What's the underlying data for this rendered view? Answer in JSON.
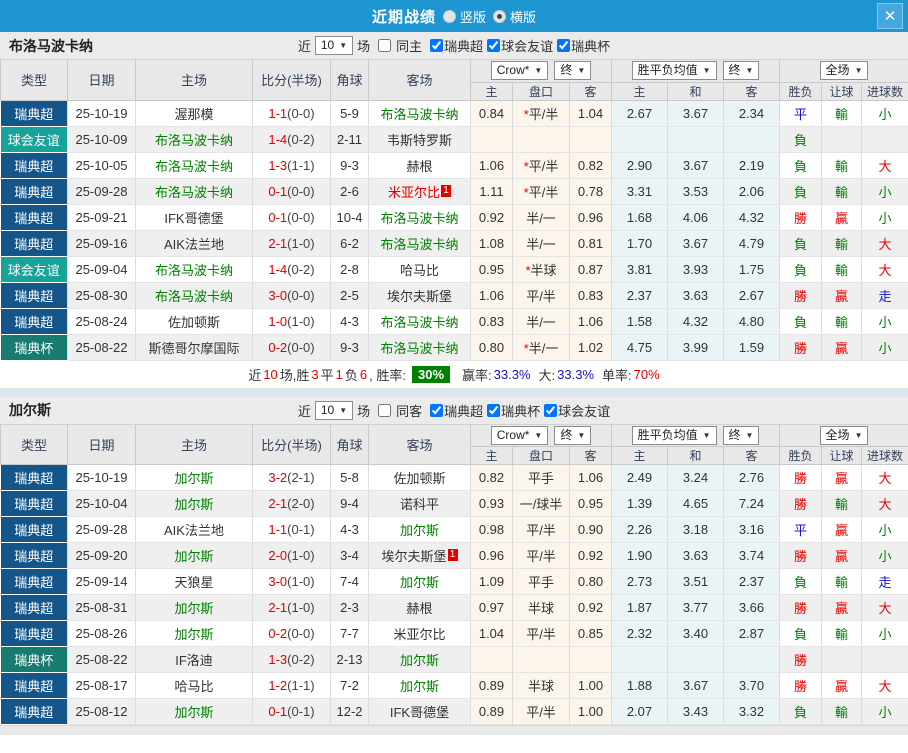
{
  "titlebar": {
    "title": "近期战绩",
    "layout_options": [
      "竖版",
      "横版"
    ],
    "layout_selected": "横版",
    "close_label": "X"
  },
  "table_header": {
    "main": [
      "类型",
      "日期",
      "主场",
      "比分(半场)",
      "角球",
      "客场"
    ],
    "odds_source_dropdown": "Crow*",
    "final_dropdown": "终",
    "mean_dropdown": "胜平负均值",
    "final2_dropdown": "终",
    "scope_dropdown": "全场",
    "sub": [
      "主",
      "盘口",
      "客",
      "主",
      "和",
      "客",
      "胜负",
      "让球",
      "进球数"
    ]
  },
  "colors": {
    "topbar_blue": "#1E96D2",
    "league_super": "#15568A",
    "league_friendly": "#17A39A",
    "league_cup": "#177B6F",
    "win_red": "#E50000",
    "lose_green": "#008000",
    "draw_blue": "#1414CC",
    "odds_col_bg": "#FCF5EC",
    "mean_col_bg": "#EAF4F7",
    "rate_badge_green": "#008000"
  },
  "sections": [
    {
      "team": "布洛马波卡纳",
      "controls": {
        "near_label": "近",
        "match_count": "10",
        "matches_label": "场",
        "same_label": "同主",
        "same_checked": false,
        "leagues": [
          "瑞典超",
          "球会友谊",
          "瑞典杯"
        ]
      },
      "rows": [
        {
          "league": "瑞典超",
          "lk": "super",
          "date": "25-10-19",
          "home": "渥那模",
          "hs": false,
          "score": "1-1",
          "half": "(0-0)",
          "corners": "5-9",
          "away": "布洛马波卡纳",
          "as": true,
          "away_red": false,
          "away_badge": "",
          "odds": [
            "0.84",
            "*平/半",
            "1.04"
          ],
          "mean": [
            "2.67",
            "3.67",
            "2.34"
          ],
          "out": [
            "平",
            "輸",
            "小"
          ],
          "oc": [
            "b",
            "g",
            "g"
          ]
        },
        {
          "league": "球会友谊",
          "lk": "friendly",
          "date": "25-10-09",
          "home": "布洛马波卡纳",
          "hs": true,
          "score": "1-4",
          "half": "(0-2)",
          "corners": "2-11",
          "away": "韦斯特罗斯",
          "as": false,
          "away_red": false,
          "away_badge": "",
          "odds": [
            "",
            "",
            ""
          ],
          "mean": [
            "",
            "",
            ""
          ],
          "out": [
            "負",
            "",
            ""
          ],
          "oc": [
            "g",
            "",
            ""
          ]
        },
        {
          "league": "瑞典超",
          "lk": "super",
          "date": "25-10-05",
          "home": "布洛马波卡纳",
          "hs": true,
          "score": "1-3",
          "half": "(1-1)",
          "corners": "9-3",
          "away": "赫根",
          "as": false,
          "away_red": false,
          "away_badge": "",
          "odds": [
            "1.06",
            "*平/半",
            "0.82"
          ],
          "mean": [
            "2.90",
            "3.67",
            "2.19"
          ],
          "out": [
            "負",
            "輸",
            "大"
          ],
          "oc": [
            "g",
            "g",
            "r"
          ]
        },
        {
          "league": "瑞典超",
          "lk": "super",
          "date": "25-09-28",
          "home": "布洛马波卡纳",
          "hs": true,
          "score": "0-1",
          "half": "(0-0)",
          "corners": "2-6",
          "away": "米亚尔比",
          "as": false,
          "away_red": true,
          "away_badge": "1",
          "odds": [
            "1.11",
            "*平/半",
            "0.78"
          ],
          "mean": [
            "3.31",
            "3.53",
            "2.06"
          ],
          "out": [
            "負",
            "輸",
            "小"
          ],
          "oc": [
            "g",
            "g",
            "g"
          ]
        },
        {
          "league": "瑞典超",
          "lk": "super",
          "date": "25-09-21",
          "home": "IFK哥德堡",
          "hs": false,
          "score": "0-1",
          "half": "(0-0)",
          "corners": "10-4",
          "away": "布洛马波卡纳",
          "as": true,
          "away_red": false,
          "away_badge": "",
          "odds": [
            "0.92",
            "半/一",
            "0.96"
          ],
          "mean": [
            "1.68",
            "4.06",
            "4.32"
          ],
          "out": [
            "勝",
            "贏",
            "小"
          ],
          "oc": [
            "r",
            "r",
            "g"
          ]
        },
        {
          "league": "瑞典超",
          "lk": "super",
          "date": "25-09-16",
          "home": "AIK法兰地",
          "hs": false,
          "score": "2-1",
          "half": "(1-0)",
          "corners": "6-2",
          "away": "布洛马波卡纳",
          "as": true,
          "away_red": false,
          "away_badge": "",
          "odds": [
            "1.08",
            "半/一",
            "0.81"
          ],
          "mean": [
            "1.70",
            "3.67",
            "4.79"
          ],
          "out": [
            "負",
            "輸",
            "大"
          ],
          "oc": [
            "g",
            "g",
            "r"
          ]
        },
        {
          "league": "球会友谊",
          "lk": "friendly",
          "date": "25-09-04",
          "home": "布洛马波卡纳",
          "hs": true,
          "score": "1-4",
          "half": "(0-2)",
          "corners": "2-8",
          "away": "哈马比",
          "as": false,
          "away_red": false,
          "away_badge": "",
          "odds": [
            "0.95",
            "*半球",
            "0.87"
          ],
          "mean": [
            "3.81",
            "3.93",
            "1.75"
          ],
          "out": [
            "負",
            "輸",
            "大"
          ],
          "oc": [
            "g",
            "g",
            "r"
          ]
        },
        {
          "league": "瑞典超",
          "lk": "super",
          "date": "25-08-30",
          "home": "布洛马波卡纳",
          "hs": true,
          "score": "3-0",
          "half": "(0-0)",
          "corners": "2-5",
          "away": "埃尔夫斯堡",
          "as": false,
          "away_red": false,
          "away_badge": "",
          "odds": [
            "1.06",
            "平/半",
            "0.83"
          ],
          "mean": [
            "2.37",
            "3.63",
            "2.67"
          ],
          "out": [
            "勝",
            "贏",
            "走"
          ],
          "oc": [
            "r",
            "r",
            "b"
          ]
        },
        {
          "league": "瑞典超",
          "lk": "super",
          "date": "25-08-24",
          "home": "佐加顿斯",
          "hs": false,
          "score": "1-0",
          "half": "(1-0)",
          "corners": "4-3",
          "away": "布洛马波卡纳",
          "as": true,
          "away_red": false,
          "away_badge": "",
          "odds": [
            "0.83",
            "半/一",
            "1.06"
          ],
          "mean": [
            "1.58",
            "4.32",
            "4.80"
          ],
          "out": [
            "負",
            "輸",
            "小"
          ],
          "oc": [
            "g",
            "g",
            "g"
          ]
        },
        {
          "league": "瑞典杯",
          "lk": "cup",
          "date": "25-08-22",
          "home": "斯德哥尔摩国际",
          "hs": false,
          "score": "0-2",
          "half": "(0-0)",
          "corners": "9-3",
          "away": "布洛马波卡纳",
          "as": true,
          "away_red": false,
          "away_badge": "",
          "odds": [
            "0.80",
            "*半/一",
            "1.02"
          ],
          "mean": [
            "4.75",
            "3.99",
            "1.59"
          ],
          "out": [
            "勝",
            "贏",
            "小"
          ],
          "oc": [
            "r",
            "r",
            "g"
          ]
        }
      ],
      "summary": {
        "near_label": "近",
        "count": "10",
        "seg1": "场,胜",
        "wins": "3",
        "seg2": "平",
        "draws": "1",
        "seg3": "负",
        "losses": "6",
        "rate_label": ", 胜率:",
        "rate": "30%",
        "win_rate_label": "赢率:",
        "win_rate": "33.3%",
        "big_label": "大:",
        "big_rate": "33.3%",
        "single_label": "单率:",
        "single_rate": "70%"
      }
    },
    {
      "team": "加尔斯",
      "controls": {
        "near_label": "近",
        "match_count": "10",
        "matches_label": "场",
        "same_label": "同客",
        "same_checked": false,
        "leagues": [
          "瑞典超",
          "瑞典杯",
          "球会友谊"
        ]
      },
      "rows": [
        {
          "league": "瑞典超",
          "lk": "super",
          "date": "25-10-19",
          "home": "加尔斯",
          "hs": true,
          "score": "3-2",
          "half": "(2-1)",
          "corners": "5-8",
          "away": "佐加顿斯",
          "as": false,
          "away_red": false,
          "away_badge": "",
          "odds": [
            "0.82",
            "平手",
            "1.06"
          ],
          "mean": [
            "2.49",
            "3.24",
            "2.76"
          ],
          "out": [
            "勝",
            "贏",
            "大"
          ],
          "oc": [
            "r",
            "r",
            "r"
          ]
        },
        {
          "league": "瑞典超",
          "lk": "super",
          "date": "25-10-04",
          "home": "加尔斯",
          "hs": true,
          "score": "2-1",
          "half": "(2-0)",
          "corners": "9-4",
          "away": "诺科平",
          "as": false,
          "away_red": false,
          "away_badge": "",
          "odds": [
            "0.93",
            "一/球半",
            "0.95"
          ],
          "mean": [
            "1.39",
            "4.65",
            "7.24"
          ],
          "out": [
            "勝",
            "輸",
            "大"
          ],
          "oc": [
            "r",
            "g",
            "r"
          ]
        },
        {
          "league": "瑞典超",
          "lk": "super",
          "date": "25-09-28",
          "home": "AIK法兰地",
          "hs": false,
          "score": "1-1",
          "half": "(0-1)",
          "corners": "4-3",
          "away": "加尔斯",
          "as": true,
          "away_red": false,
          "away_badge": "",
          "odds": [
            "0.98",
            "平/半",
            "0.90"
          ],
          "mean": [
            "2.26",
            "3.18",
            "3.16"
          ],
          "out": [
            "平",
            "贏",
            "小"
          ],
          "oc": [
            "b",
            "r",
            "g"
          ]
        },
        {
          "league": "瑞典超",
          "lk": "super",
          "date": "25-09-20",
          "home": "加尔斯",
          "hs": true,
          "score": "2-0",
          "half": "(1-0)",
          "corners": "3-4",
          "away": "埃尔夫斯堡",
          "as": false,
          "away_red": false,
          "away_badge": "1",
          "odds": [
            "0.96",
            "平/半",
            "0.92"
          ],
          "mean": [
            "1.90",
            "3.63",
            "3.74"
          ],
          "out": [
            "勝",
            "贏",
            "小"
          ],
          "oc": [
            "r",
            "r",
            "g"
          ]
        },
        {
          "league": "瑞典超",
          "lk": "super",
          "date": "25-09-14",
          "home": "天狼星",
          "hs": false,
          "score": "3-0",
          "half": "(1-0)",
          "corners": "7-4",
          "away": "加尔斯",
          "as": true,
          "away_red": false,
          "away_badge": "",
          "odds": [
            "1.09",
            "平手",
            "0.80"
          ],
          "mean": [
            "2.73",
            "3.51",
            "2.37"
          ],
          "out": [
            "負",
            "輸",
            "走"
          ],
          "oc": [
            "g",
            "g",
            "b"
          ]
        },
        {
          "league": "瑞典超",
          "lk": "super",
          "date": "25-08-31",
          "home": "加尔斯",
          "hs": true,
          "score": "2-1",
          "half": "(1-0)",
          "corners": "2-3",
          "away": "赫根",
          "as": false,
          "away_red": false,
          "away_badge": "",
          "odds": [
            "0.97",
            "半球",
            "0.92"
          ],
          "mean": [
            "1.87",
            "3.77",
            "3.66"
          ],
          "out": [
            "勝",
            "贏",
            "大"
          ],
          "oc": [
            "r",
            "r",
            "r"
          ]
        },
        {
          "league": "瑞典超",
          "lk": "super",
          "date": "25-08-26",
          "home": "加尔斯",
          "hs": true,
          "score": "0-2",
          "half": "(0-0)",
          "corners": "7-7",
          "away": "米亚尔比",
          "as": false,
          "away_red": false,
          "away_badge": "",
          "odds": [
            "1.04",
            "平/半",
            "0.85"
          ],
          "mean": [
            "2.32",
            "3.40",
            "2.87"
          ],
          "out": [
            "負",
            "輸",
            "小"
          ],
          "oc": [
            "g",
            "g",
            "g"
          ]
        },
        {
          "league": "瑞典杯",
          "lk": "cup",
          "date": "25-08-22",
          "home": "IF洛迪",
          "hs": false,
          "score": "1-3",
          "half": "(0-2)",
          "corners": "2-13",
          "away": "加尔斯",
          "as": true,
          "away_red": false,
          "away_badge": "",
          "odds": [
            "",
            "",
            ""
          ],
          "mean": [
            "",
            "",
            ""
          ],
          "out": [
            "勝",
            "",
            ""
          ],
          "oc": [
            "r",
            "",
            ""
          ]
        },
        {
          "league": "瑞典超",
          "lk": "super",
          "date": "25-08-17",
          "home": "哈马比",
          "hs": false,
          "score": "1-2",
          "half": "(1-1)",
          "corners": "7-2",
          "away": "加尔斯",
          "as": true,
          "away_red": false,
          "away_badge": "",
          "odds": [
            "0.89",
            "半球",
            "1.00"
          ],
          "mean": [
            "1.88",
            "3.67",
            "3.70"
          ],
          "out": [
            "勝",
            "贏",
            "大"
          ],
          "oc": [
            "r",
            "r",
            "r"
          ]
        },
        {
          "league": "瑞典超",
          "lk": "super",
          "date": "25-08-12",
          "home": "加尔斯",
          "hs": true,
          "score": "0-1",
          "half": "(0-1)",
          "corners": "12-2",
          "away": "IFK哥德堡",
          "as": false,
          "away_red": false,
          "away_badge": "",
          "odds": [
            "0.89",
            "平/半",
            "1.00"
          ],
          "mean": [
            "2.07",
            "3.43",
            "3.32"
          ],
          "out": [
            "負",
            "輸",
            "小"
          ],
          "oc": [
            "g",
            "g",
            "g"
          ]
        }
      ],
      "summary": null
    }
  ]
}
